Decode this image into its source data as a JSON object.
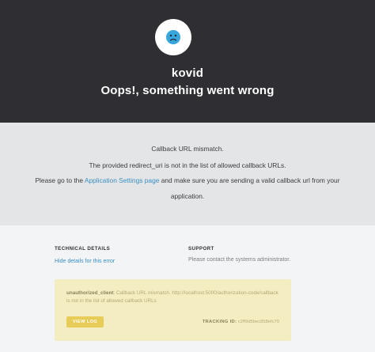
{
  "header": {
    "app_name": "kovid",
    "headline": "Oops!, something went wrong",
    "avatar_icon": "sad-face-icon"
  },
  "message": {
    "line1": "Callback URL mismatch.",
    "line2": "The provided redirect_uri is not in the list of allowed callback URLs.",
    "line3_prefix": "Please go to the ",
    "line3_link": "Application Settings page",
    "line3_suffix": " and make sure you are sending a valid callback url from your",
    "line4": "application."
  },
  "technical": {
    "title": "TECHNICAL DETAILS",
    "hide_link": "Hide details for this error"
  },
  "support": {
    "title": "SUPPORT",
    "text": "Please contact the systems administrator."
  },
  "error": {
    "code": "unauthorized_client",
    "message": ": Callback URL mismatch. http://localhost:5000/authorization-code/callback is not in the list of allowed callback URLs",
    "view_log_label": "VIEW LOG",
    "tracking_label": "TRACKING ID:",
    "tracking_id": "c2ff9d5bec858efc70"
  },
  "colors": {
    "header_bg": "#2f2f33",
    "message_bg": "#e4e5e6",
    "details_bg": "#f3f4f6",
    "error_bg": "#f4edc2",
    "button_bg": "#e7cc57",
    "link": "#3a8fc2"
  }
}
